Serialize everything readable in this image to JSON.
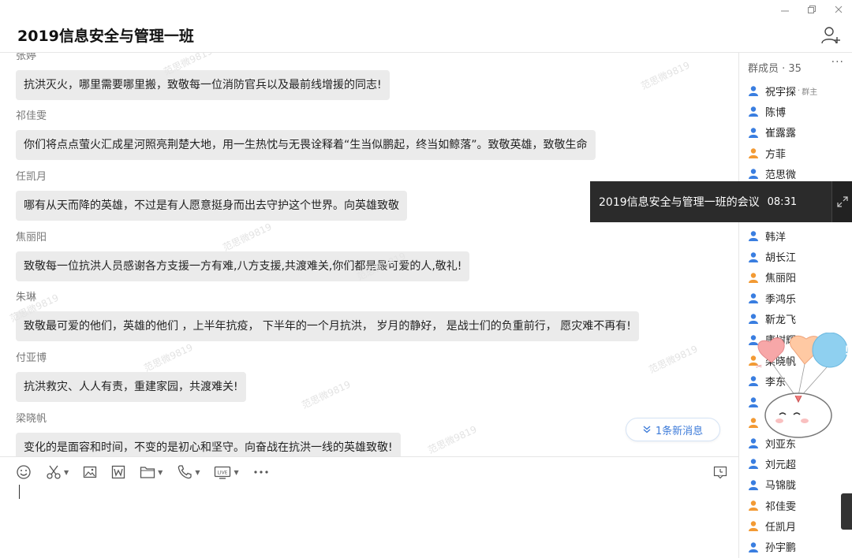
{
  "window": {
    "title": "2019信息安全与管理一班",
    "buttons": [
      "minimize",
      "restore",
      "close"
    ]
  },
  "messages": [
    {
      "sender": "张婷",
      "text": "抗洪灭火，哪里需要哪里搬，致敬每一位消防官兵以及最前线增援的同志!"
    },
    {
      "sender": "祁佳雯",
      "text": "你们将点点萤火汇成星河照亮荆楚大地，用一生热忱与无畏诠释着“生当似鹏起，终当如鲸落”。致敬英雄，致敬生命"
    },
    {
      "sender": "任凯月",
      "text": "哪有从天而降的英雄，不过是有人愿意挺身而出去守护这个世界。向英雄致敬"
    },
    {
      "sender": "焦丽阳",
      "text": "致敬每一位抗洪人员感谢各方支援一方有难,八方支援,共渡难关,你们都是最可爱的人,敬礼!"
    },
    {
      "sender": "朱琳",
      "text": "致敬最可爱的他们，英雄的他们 ，上半年抗疫， 下半年的一个月抗洪， 岁月的静好， 是战士们的负重前行， 愿灾难不再有!"
    },
    {
      "sender": "付亚博",
      "text": "抗洪救灾、人人有责，重建家园，共渡难关!"
    },
    {
      "sender": "梁晓帆",
      "text": "变化的是面容和时间，不变的是初心和坚守。向奋战在抗洪一线的英雄致敬!"
    }
  ],
  "watermark": "范思微9819",
  "new_message_button": "1条新消息",
  "toolbar": {
    "icons": [
      "emoji-icon",
      "scissors-icon",
      "image-icon",
      "word-doc-icon",
      "folder-icon",
      "phone-icon",
      "live-icon",
      "more-icon",
      "chat-history-icon"
    ]
  },
  "sidebar": {
    "header": "群成员 · 35",
    "more": "···",
    "owner_tag": "群主",
    "members": [
      {
        "name": "祝宇探",
        "color": "#3a7ee0",
        "owner": true
      },
      {
        "name": "陈博",
        "color": "#3a7ee0"
      },
      {
        "name": "崔露露",
        "color": "#3a7ee0"
      },
      {
        "name": "方菲",
        "color": "#f29a34"
      },
      {
        "name": "范思微",
        "color": "#3a7ee0"
      },
      {
        "name": "",
        "color": "#3a7ee0"
      },
      {
        "name": "",
        "color": "#3a7ee0"
      },
      {
        "name": "韩洋",
        "color": "#3a7ee0"
      },
      {
        "name": "胡长江",
        "color": "#3a7ee0"
      },
      {
        "name": "焦丽阳",
        "color": "#f29a34"
      },
      {
        "name": "季鸿乐",
        "color": "#3a7ee0"
      },
      {
        "name": "靳龙飞",
        "color": "#3a7ee0"
      },
      {
        "name": "康树辉",
        "color": "#3a7ee0"
      },
      {
        "name": "梁晓帆",
        "color": "#f29a34"
      },
      {
        "name": "李东",
        "color": "#3a7ee0"
      },
      {
        "name": "",
        "color": "#3a7ee0"
      },
      {
        "name": "",
        "color": "#f29a34"
      },
      {
        "name": "刘亚东",
        "color": "#3a7ee0"
      },
      {
        "name": "刘元超",
        "color": "#3a7ee0"
      },
      {
        "name": "马锦胧",
        "color": "#3a7ee0"
      },
      {
        "name": "祁佳雯",
        "color": "#f29a34"
      },
      {
        "name": "任凯月",
        "color": "#f29a34"
      },
      {
        "name": "孙宇鹏",
        "color": "#3a7ee0"
      }
    ]
  },
  "meeting_popup": {
    "title": "2019信息安全与管理一班的会议",
    "time": "08:31"
  }
}
